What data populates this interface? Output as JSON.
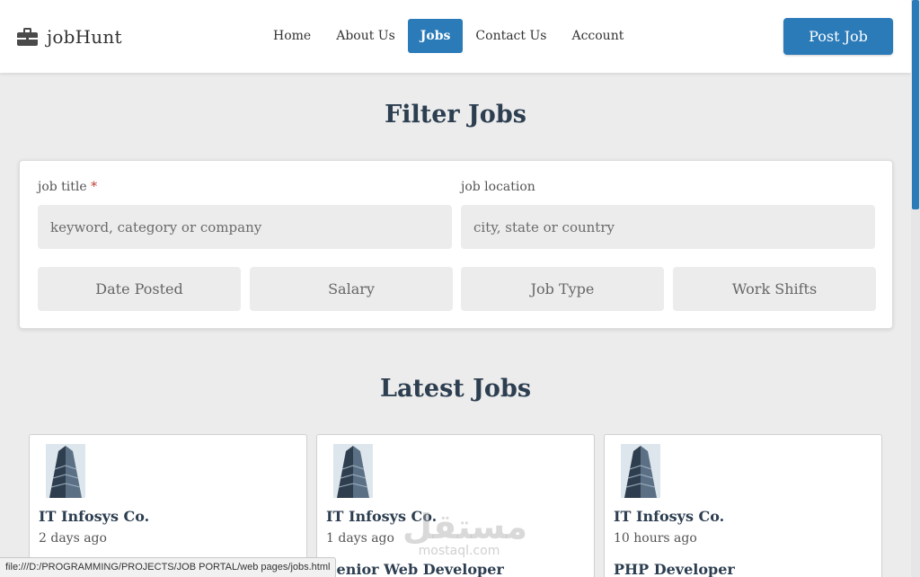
{
  "brand": {
    "name": "jobHunt",
    "icon": "briefcase-icon"
  },
  "nav": {
    "links": [
      {
        "label": "Home",
        "active": false
      },
      {
        "label": "About Us",
        "active": false
      },
      {
        "label": "Jobs",
        "active": true
      },
      {
        "label": "Contact Us",
        "active": false
      },
      {
        "label": "Account",
        "active": false
      }
    ],
    "post_job_label": "Post Job"
  },
  "filter": {
    "title": "Filter Jobs",
    "job_title_label": "job title",
    "required_mark": "*",
    "job_title_placeholder": "keyword, category or company",
    "job_location_label": "job location",
    "job_location_placeholder": "city, state or country",
    "buttons": [
      "Date Posted",
      "Salary",
      "Job Type",
      "Work Shifts"
    ]
  },
  "latest": {
    "title": "Latest Jobs",
    "jobs": [
      {
        "company": "IT Infosys Co.",
        "posted": "2 days ago",
        "title": ""
      },
      {
        "company": "IT Infosys Co.",
        "posted": "1 days ago",
        "title": "Senior Web Developer"
      },
      {
        "company": "IT Infosys Co.",
        "posted": "10 hours ago",
        "title": "PHP Developer"
      }
    ]
  },
  "watermark": {
    "arabic": "مستقل",
    "latin": "mostaql.com"
  },
  "status_bar": {
    "url": "file:///D:/PROGRAMMING/PROJECTS/JOB PORTAL/web pages/jobs.html"
  },
  "colors": {
    "accent": "#2b7bb9",
    "heading": "#2c3e50",
    "background": "#ececec"
  }
}
